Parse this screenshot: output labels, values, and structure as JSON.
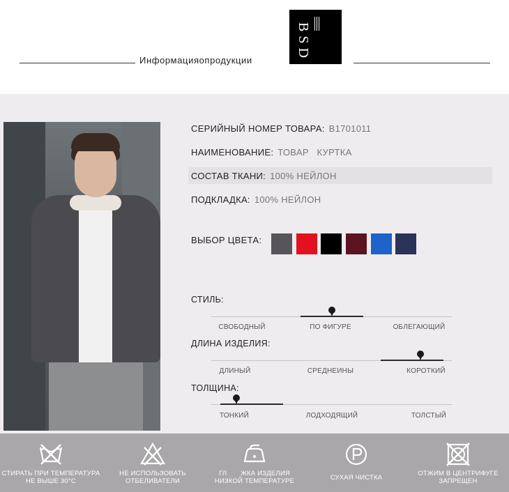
{
  "header": {
    "title": "Информацияопродукции",
    "logo_text": "BSD"
  },
  "specs": [
    {
      "key": "СЕРИЙНЫЙ НОМЕР ТОВАРА:",
      "value": "B1701011"
    },
    {
      "key": "НАИМЕНОВАНИЕ:",
      "value": "ТОВАР   КУРТКА"
    },
    {
      "key": "СОСТАВ ТКАНИ:",
      "value": "100% НЕЙЛОН"
    },
    {
      "key": "ПОДКЛАДКА:",
      "value": "100% НЕЙЛОН"
    }
  ],
  "colors": {
    "label": "ВЫБОР ЦВЕТА:",
    "swatches": [
      "#58555a",
      "#e3101d",
      "#000000",
      "#5c1420",
      "#1e63c9",
      "#2a3358"
    ]
  },
  "scales": [
    {
      "label": "СТИЛЬ:",
      "options": [
        "СВОБОДНЫЙ",
        "ПО ФИГУРЕ",
        "ОБЛЕГАЮЩИЙ"
      ],
      "selected": 1
    },
    {
      "label": "ДЛИНА ИЗДЕЛИЯ:",
      "options": [
        "ДЛИНЫЙ",
        "СРЕДНЕИНЫ",
        "КОРОТКИЙ"
      ],
      "selected": 2
    },
    {
      "label": "ТОЛЩИНА:",
      "options": [
        "ТОНКИЙ",
        "ЛОДХОДЯЩИЙ",
        "ТОЛСТЫЙ"
      ],
      "selected": 0
    }
  ],
  "care": [
    {
      "icon": "no-machine-wash-icon",
      "lines": [
        "СТИРАТЬ ПРИ ТЕМПЕРАТУРА",
        "НЕ ВЫШЕ 30°C"
      ]
    },
    {
      "icon": "no-bleach-icon",
      "lines": [
        "НЕ ИСПОЛЬЗОВАТЬ",
        "ОТБЕЛИВАТЕЛИ"
      ]
    },
    {
      "icon": "iron-low-icon",
      "lines": [
        "ГЛ       ЖКА ИЗДЕЛИЯ",
        "НИЗКОЙ ТЕМПЕРАТУРЕ"
      ]
    },
    {
      "icon": "dry-clean-p-icon",
      "lines": [
        "СУХАЯ ЧИСТКА"
      ]
    },
    {
      "icon": "no-tumble-dry-icon",
      "lines": [
        "ОТЖИМ В ЦЕНТРИФУГЕ",
        "ЗАПРЕЩЕН"
      ]
    }
  ]
}
